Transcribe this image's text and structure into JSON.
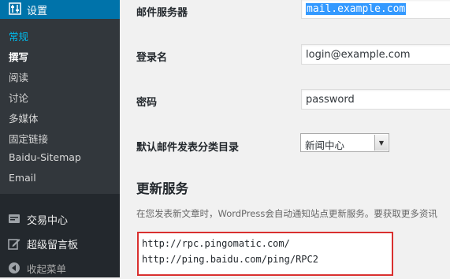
{
  "sidebar": {
    "header_label": "设置",
    "header_icon": "settings-sliders-icon",
    "submenu": [
      {
        "label": "常规",
        "state": "current"
      },
      {
        "label": "撰写",
        "state": "bold"
      },
      {
        "label": "阅读",
        "state": "normal"
      },
      {
        "label": "讨论",
        "state": "normal"
      },
      {
        "label": "多媒体",
        "state": "normal"
      },
      {
        "label": "固定链接",
        "state": "normal"
      },
      {
        "label": "Baidu-Sitemap",
        "state": "normal"
      },
      {
        "label": "Email",
        "state": "normal"
      }
    ],
    "menu": [
      {
        "label": "交易中心",
        "icon": "cart-icon"
      },
      {
        "label": "超级留言板",
        "icon": "edit-icon"
      }
    ],
    "collapse_label": "收起菜单",
    "collapse_icon": "collapse-arrow-icon"
  },
  "form": {
    "mail_server": {
      "label": "邮件服务器",
      "value": "mail.example.com"
    },
    "login": {
      "label": "登录名",
      "value": "login@example.com"
    },
    "password": {
      "label": "密码",
      "value": "password"
    },
    "default_category": {
      "label": "默认邮件发表分类目录",
      "value": "新闻中心"
    }
  },
  "update_services": {
    "title": "更新服务",
    "description": "在您发表新文章时，WordPress会自动通知站点更新服务。要获取更多资讯",
    "ping_sites": [
      "http://rpc.pingomatic.com/",
      "http://ping.baidu.com/ping/RPC2"
    ]
  },
  "colors": {
    "sidebar_bg": "#23282d",
    "active_menu": "#0073aa",
    "current_submenu": "#00b9eb",
    "highlight_border": "#d9302f"
  }
}
